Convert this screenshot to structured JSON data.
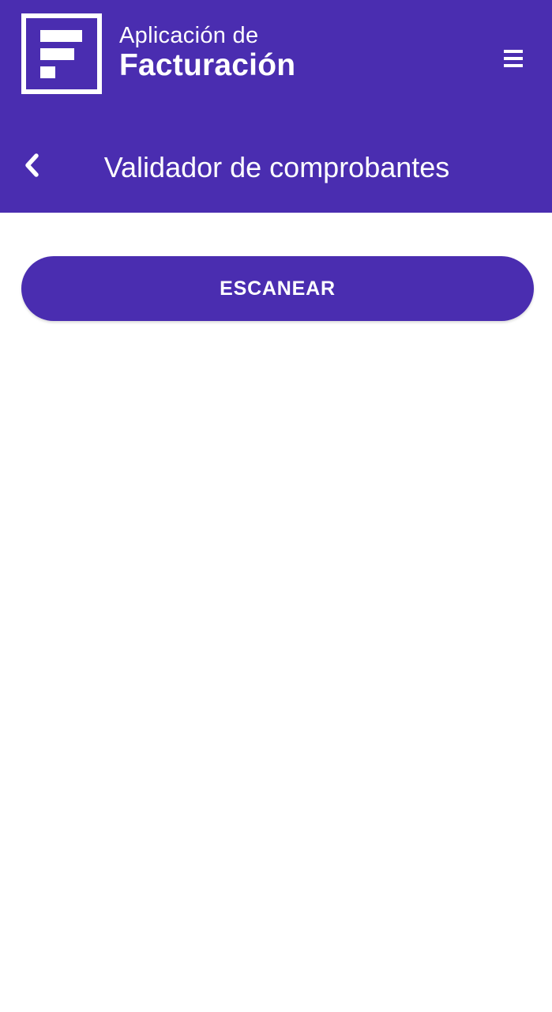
{
  "header": {
    "brand_line1": "Aplicación de",
    "brand_line2": "Facturación",
    "logo_icon": "facturacion-f-logo",
    "menu_icon": "hamburger-menu-icon"
  },
  "toolbar": {
    "back_icon": "chevron-left-icon",
    "title": "Validador de comprobantes"
  },
  "main": {
    "scan_label": "ESCANEAR"
  },
  "colors": {
    "primary": "#4a2db0",
    "on_primary": "#ffffff",
    "background": "#ffffff"
  }
}
